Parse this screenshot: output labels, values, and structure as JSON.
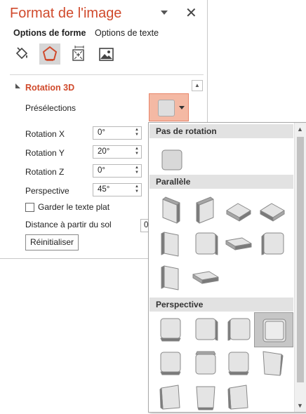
{
  "pane": {
    "title": "Format de l'image",
    "tabs": [
      "Options de forme",
      "Options de texte"
    ],
    "icons": [
      "fill-line-icon",
      "effects-icon",
      "size-properties-icon",
      "picture-icon"
    ]
  },
  "section": {
    "title": "Rotation 3D",
    "presets_label": "Présélections",
    "rotation_x_label": "Rotation X",
    "rotation_x_value": "0°",
    "rotation_y_label": "Rotation Y",
    "rotation_y_value": "20°",
    "rotation_z_label": "Rotation Z",
    "rotation_z_value": "0°",
    "perspective_label": "Perspective",
    "perspective_value": "45°",
    "keep_flat_label": "Garder le texte plat",
    "keep_flat_checked": false,
    "ground_label": "Distance à partir du sol",
    "ground_value": "0",
    "reset_label": "Réinitialiser"
  },
  "gallery": {
    "groups": [
      {
        "title": "Pas de rotation",
        "count": 1
      },
      {
        "title": "Parallèle",
        "count": 10
      },
      {
        "title": "Perspective",
        "count": 11
      }
    ],
    "selected": "perspective-4"
  },
  "colors": {
    "accent": "#d04a2c",
    "preset_button": "#f4b9a4",
    "header_bg": "#e2e2e2",
    "selected_bg": "#c6c6c6"
  }
}
